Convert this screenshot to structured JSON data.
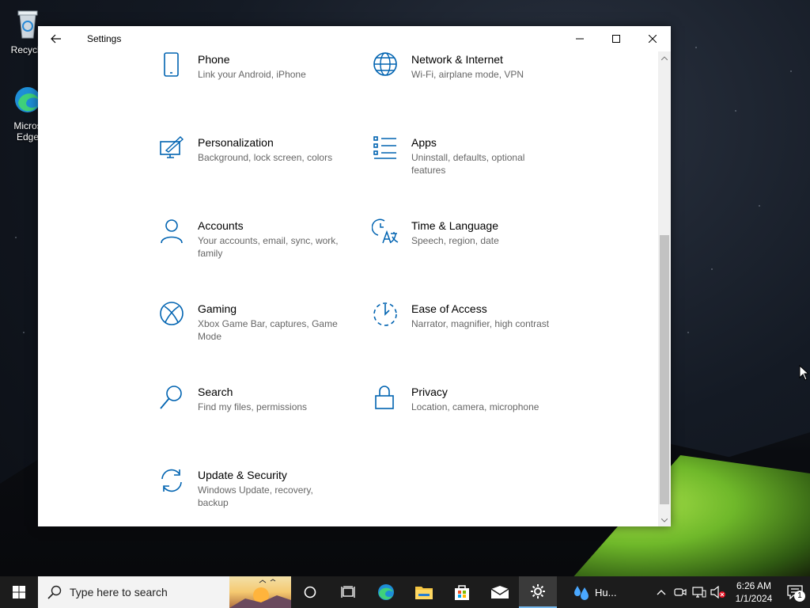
{
  "desktop": {
    "icons": [
      {
        "label": "Recycle",
        "icon": "recycle-bin-icon"
      },
      {
        "label": "Micros",
        "label2": "Edge",
        "icon": "edge-icon"
      }
    ]
  },
  "window": {
    "title": "Settings",
    "tiles": [
      {
        "name": "Phone",
        "desc": "Link your Android, iPhone",
        "icon": "phone-icon"
      },
      {
        "name": "Network & Internet",
        "desc": "Wi-Fi, airplane mode, VPN",
        "icon": "globe-icon"
      },
      {
        "name": "Personalization",
        "desc": "Background, lock screen, colors",
        "icon": "personalization-icon"
      },
      {
        "name": "Apps",
        "desc": "Uninstall, defaults, optional features",
        "icon": "apps-list-icon"
      },
      {
        "name": "Accounts",
        "desc": "Your accounts, email, sync, work, family",
        "icon": "person-icon"
      },
      {
        "name": "Time & Language",
        "desc": "Speech, region, date",
        "icon": "time-language-icon"
      },
      {
        "name": "Gaming",
        "desc": "Xbox Game Bar, captures, Game Mode",
        "icon": "xbox-icon"
      },
      {
        "name": "Ease of Access",
        "desc": "Narrator, magnifier, high contrast",
        "icon": "ease-of-access-icon"
      },
      {
        "name": "Search",
        "desc": "Find my files, permissions",
        "icon": "magnifier-icon"
      },
      {
        "name": "Privacy",
        "desc": "Location, camera, microphone",
        "icon": "lock-icon"
      },
      {
        "name": "Update & Security",
        "desc": "Windows Update, recovery, backup",
        "icon": "sync-icon"
      }
    ]
  },
  "taskbar": {
    "search_placeholder": "Type here to search",
    "weather_label": "Hu...",
    "time": "6:26 AM",
    "date": "1/1/2024",
    "notification_count": "1"
  },
  "colors": {
    "accent": "#0063b1",
    "taskbar": "#1c1c1c"
  }
}
